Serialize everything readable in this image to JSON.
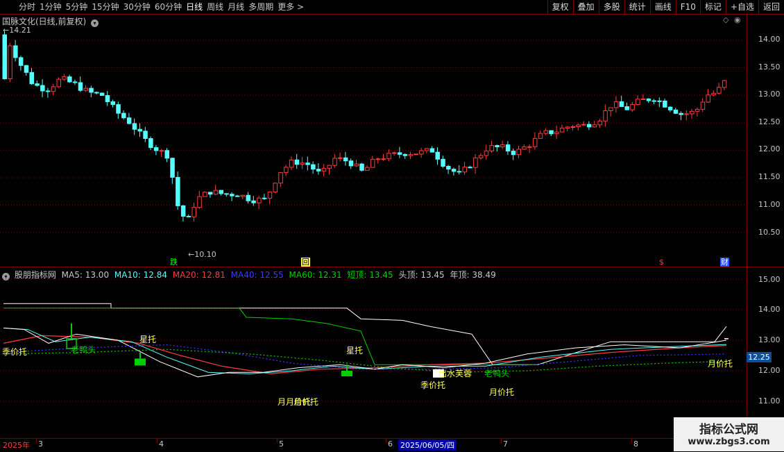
{
  "toolbar": {
    "timeframes": [
      "分时",
      "1分钟",
      "5分钟",
      "15分钟",
      "30分钟",
      "60分钟",
      "日线",
      "周线",
      "月线",
      "多周期",
      "更多 >"
    ],
    "active": "日线",
    "right_buttons": [
      "复权",
      "叠加",
      "多股",
      "统计",
      "画线",
      "F10",
      "标记",
      "+自选",
      "返回"
    ]
  },
  "price_pane": {
    "title": "国脉文化(日线,前复权)",
    "high_label": "14.21",
    "low_label": "10.10",
    "axis_labels": [
      "14.00",
      "13.50",
      "13.00",
      "12.50",
      "12.00",
      "11.50",
      "11.00",
      "10.50"
    ],
    "markers": {
      "die": "跌",
      "hui": "回",
      "dollar": "$",
      "cai": "财"
    }
  },
  "indicator_pane": {
    "name": "股朋指标网",
    "ma5": "MA5: 13.00",
    "ma10": "MA10: 12.84",
    "ma20": "MA20: 12.81",
    "ma40": "MA40: 12.55",
    "ma60": "MA60: 12.31",
    "short_top": "短顶: 13.45",
    "head_top": "头顶: 13.45",
    "year_top": "年顶: 38.49",
    "axis_labels": [
      "15.00",
      "14.00",
      "13.00",
      "12.00",
      "11.00"
    ],
    "current_price": "12.25",
    "annotations": {
      "season_support": "季价托",
      "duck_head": "老鸭头",
      "star_support": "星托",
      "star_support_2": "星托",
      "month_support_1": "月",
      "month_support_2": "月价托",
      "month_support_3": "月价托",
      "season_support_2": "季价托",
      "lotus": "出水芙蓉",
      "duck_head_2": "老鸭头"
    }
  },
  "date_axis": {
    "labels": [
      "2025年",
      "3",
      "4",
      "5",
      "6",
      "7",
      "8"
    ],
    "highlight": "2025/06/05/四"
  },
  "watermark": {
    "line1": "指标公式网",
    "line2": "www.zbgs3.com"
  },
  "colors": {
    "bull": "#ff3c3c",
    "bear": "#54ffff",
    "grid": "#800000",
    "ma5": "#ffffff",
    "ma10": "#54ffff",
    "ma20": "#ff3c3c",
    "ma40": "#3c3cff",
    "ma60": "#00d000",
    "annotation": "#ffff54"
  }
}
